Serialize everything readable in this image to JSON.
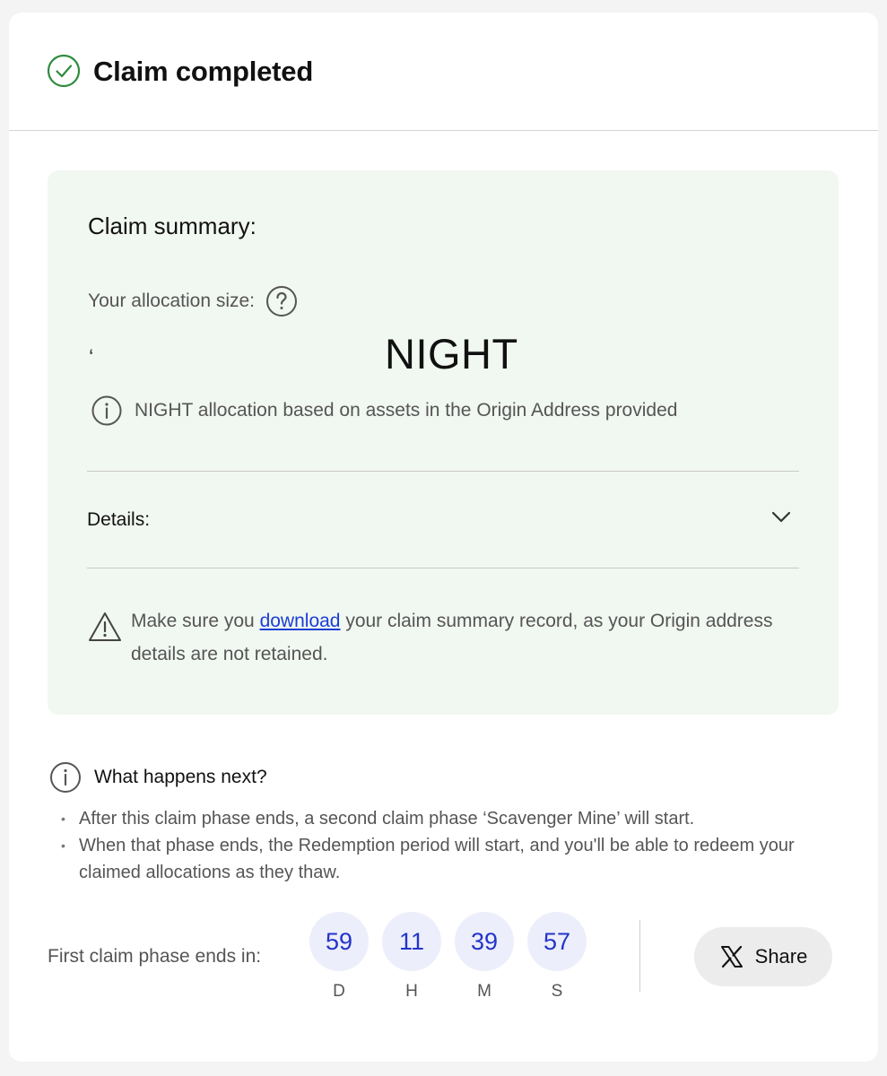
{
  "header": {
    "title": "Claim completed"
  },
  "summary": {
    "title": "Claim summary:",
    "allocation_label": "Your allocation size:",
    "allocation_value_mark": "‘",
    "allocation_unit": "NIGHT",
    "info_text": "NIGHT allocation based on assets in the Origin Address provided",
    "details_label": "Details:",
    "warning_before_link": "Make sure you ",
    "warning_link": "download",
    "warning_after_link": " your claim summary record, as your Origin address details are not retained."
  },
  "next": {
    "title": "What happens next?",
    "bullets": [
      "After this claim phase ends, a second claim phase ‘Scavenger Mine’ will start.",
      "When that phase ends, the Redemption period will start, and you'll be able to redeem your claimed allocations as they thaw."
    ]
  },
  "timer": {
    "label": "First claim phase ends in:",
    "days": "59",
    "days_unit": "D",
    "hours": "11",
    "hours_unit": "H",
    "minutes": "39",
    "minutes_unit": "M",
    "seconds": "57",
    "seconds_unit": "S"
  },
  "share": {
    "label": "Share"
  },
  "colors": {
    "success_green": "#2e8b3e",
    "summary_bg": "#f1f7f1",
    "link_blue": "#1a3fd6",
    "timer_text": "#2434c9",
    "timer_bg": "#eceefb"
  },
  "icons": [
    "check-circle-icon",
    "help-circle-icon",
    "info-icon",
    "chevron-down-icon",
    "warning-triangle-icon",
    "x-logo-icon"
  ]
}
